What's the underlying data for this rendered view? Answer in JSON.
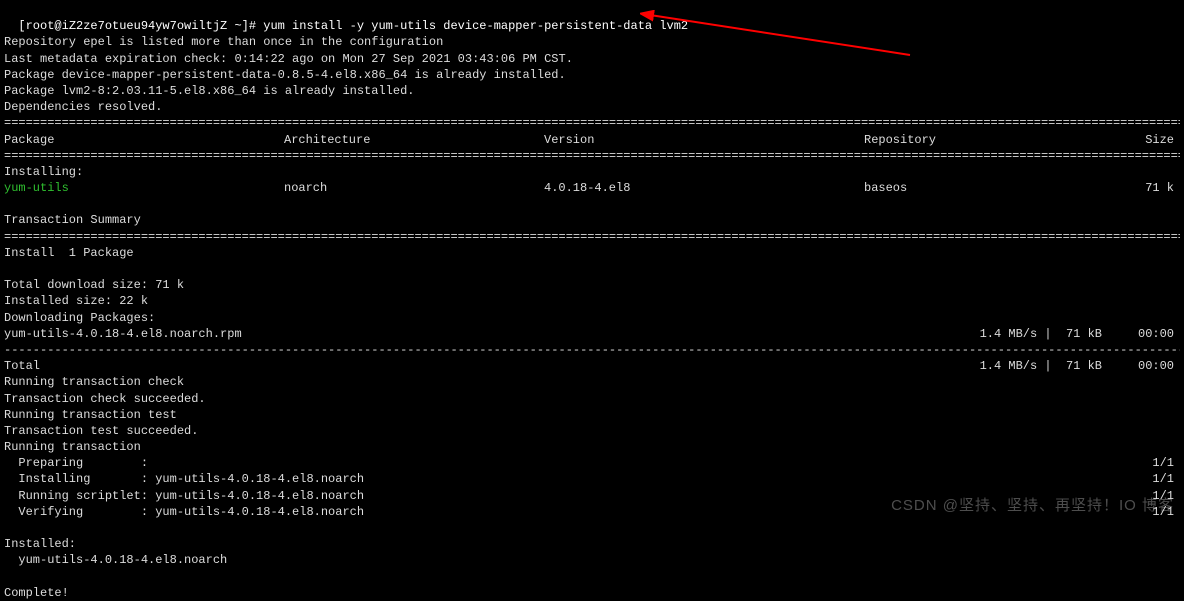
{
  "prompt": "[root@iZ2ze7otueu94yw7owiltjZ ~]# ",
  "command": "yum install -y yum-utils device-mapper-persistent-data lvm2",
  "preamble": [
    "Repository epel is listed more than once in the configuration",
    "Last metadata expiration check: 0:14:22 ago on Mon 27 Sep 2021 03:43:06 PM CST.",
    "Package device-mapper-persistent-data-0.8.5-4.el8.x86_64 is already installed.",
    "Package lvm2-8:2.03.11-5.el8.x86_64 is already installed.",
    "Dependencies resolved."
  ],
  "columns": {
    "pkg": "Package",
    "arch": "Architecture",
    "ver": "Version",
    "repo": "Repository",
    "size": "Size"
  },
  "installing_label": "Installing:",
  "install_row": {
    "pkg": " yum-utils",
    "arch": "noarch",
    "ver": "4.0.18-4.el8",
    "repo": "baseos",
    "size": "71 k"
  },
  "txn_summary": "Transaction Summary",
  "install_count": "Install  1 Package",
  "sizes": [
    "Total download size: 71 k",
    "Installed size: 22 k",
    "Downloading Packages:"
  ],
  "download": {
    "name": "yum-utils-4.0.18-4.el8.noarch.rpm",
    "stats": "1.4 MB/s |  71 kB     00:00"
  },
  "total": {
    "label": "Total",
    "stats": "1.4 MB/s |  71 kB     00:00"
  },
  "txn_lines": [
    "Running transaction check",
    "Transaction check succeeded.",
    "Running transaction test",
    "Transaction test succeeded.",
    "Running transaction"
  ],
  "progress": [
    {
      "left": "  Preparing        :",
      "right": "1/1"
    },
    {
      "left": "  Installing       : yum-utils-4.0.18-4.el8.noarch",
      "right": "1/1"
    },
    {
      "left": "  Running scriptlet: yum-utils-4.0.18-4.el8.noarch",
      "right": "1/1"
    },
    {
      "left": "  Verifying        : yum-utils-4.0.18-4.el8.noarch",
      "right": "1/1"
    }
  ],
  "installed_label": "Installed:",
  "installed_pkg": "  yum-utils-4.0.18-4.el8.noarch",
  "complete": "Complete!",
  "watermark": "CSDN @坚持、坚持、再坚持！IO 博客"
}
